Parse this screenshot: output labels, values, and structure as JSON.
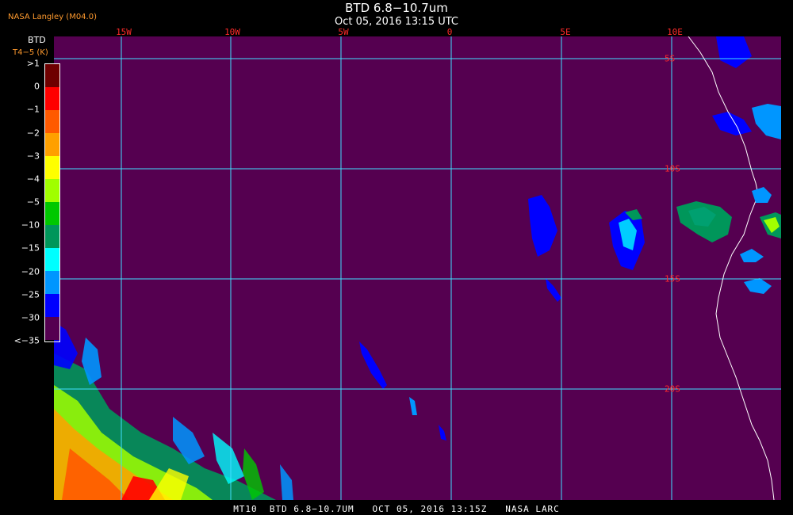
{
  "header": {
    "title": "BTD 6.8−10.7um",
    "subtitle": "Oct 05, 2016 13:15 UTC",
    "credit": "NASA Langley (M04.0)"
  },
  "colorbar": {
    "title": "BTD",
    "units": "T4−5 (K)",
    "labels": [
      ">1",
      "0",
      "−1",
      "−2",
      "−3",
      "−4",
      "−5",
      "−10",
      "−15",
      "−20",
      "−25",
      "−30",
      "<−35"
    ],
    "colors": [
      "#6e0000",
      "#ff0000",
      "#ff5a00",
      "#ffa000",
      "#ffff00",
      "#a0ff00",
      "#00c800",
      "#00965a",
      "#00ffff",
      "#0096ff",
      "#0000ff",
      "#550050"
    ]
  },
  "grid": {
    "longitudes": [
      "15W",
      "10W",
      "5W",
      "0",
      "5E",
      "10E"
    ],
    "latitudes": [
      "5S",
      "10S",
      "15S",
      "20S"
    ],
    "line_color": "#40e0ff",
    "label_color": "#ff2a2a"
  },
  "footer": {
    "text": "MT10  BTD 6.8−10.7UM   OCT 05, 2016 13:15Z   NASA LARC"
  },
  "palette": {
    "background": "#550050",
    "coastline": "#ffffff"
  }
}
